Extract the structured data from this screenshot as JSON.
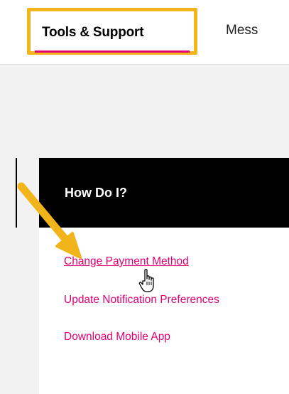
{
  "nav": {
    "tabs": [
      {
        "label": "Tools & Support"
      },
      {
        "label": "Mess"
      }
    ]
  },
  "card": {
    "title": "How Do I?",
    "links": [
      {
        "label": "Change Payment Method"
      },
      {
        "label": "Update Notification Preferences"
      },
      {
        "label": "Download Mobile App"
      }
    ]
  },
  "colors": {
    "highlight": "#f2b41b",
    "brand_magenta": "#e20074",
    "header_bg": "#000000",
    "page_bg": "#f2f2f2"
  },
  "icons": {
    "annotation": "callout-arrow-icon",
    "pointer": "hand-pointer-icon"
  }
}
